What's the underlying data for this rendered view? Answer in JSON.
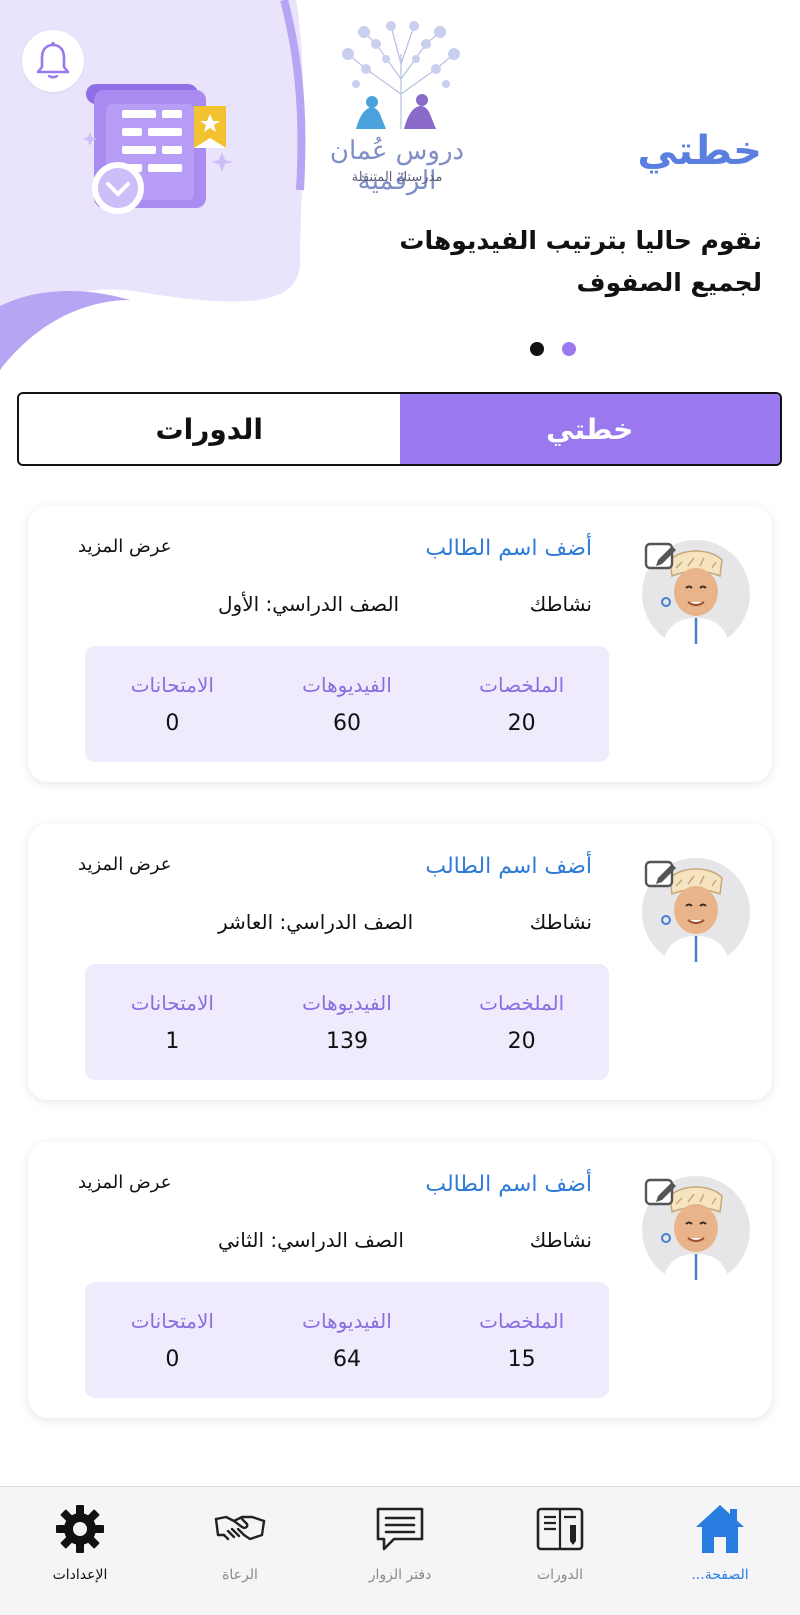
{
  "header": {
    "banner_title": "خطتي",
    "banner_text": "نقوم حاليا بترتيب الفيديوهات لجميع الصفوف",
    "logo_line1": "دروس عُمان الرقمية",
    "logo_line2": "مدرستك المتنقلة",
    "carousel_active_index": 1,
    "carousel_count": 2
  },
  "tabs": {
    "courses": "الدورات",
    "plan": "خطتي",
    "selected": "plan"
  },
  "students": [
    {
      "add_name": "أضف اسم الطالب",
      "more": "عرض المزيد",
      "activity": "نشاطك",
      "grade": "الصف الدراسي: الأول",
      "stats": [
        {
          "label": "الملخصات",
          "value": "20"
        },
        {
          "label": "الفيديوهات",
          "value": "60"
        },
        {
          "label": "الامتحانات",
          "value": "0"
        }
      ]
    },
    {
      "add_name": "أضف اسم الطالب",
      "more": "عرض المزيد",
      "activity": "نشاطك",
      "grade": "الصف الدراسي: العاشر",
      "stats": [
        {
          "label": "الملخصات",
          "value": "20"
        },
        {
          "label": "الفيديوهات",
          "value": "139"
        },
        {
          "label": "الامتحانات",
          "value": "1"
        }
      ]
    },
    {
      "add_name": "أضف اسم الطالب",
      "more": "عرض المزيد",
      "activity": "نشاطك",
      "grade": "الصف الدراسي: الثاني",
      "stats": [
        {
          "label": "الملخصات",
          "value": "15"
        },
        {
          "label": "الفيديوهات",
          "value": "64"
        },
        {
          "label": "الامتحانات",
          "value": "0"
        }
      ]
    }
  ],
  "bottom_nav": [
    {
      "label": "الإعدادات",
      "icon": "gear-icon"
    },
    {
      "label": "الرعاة",
      "icon": "handshake-icon"
    },
    {
      "label": "دفتر الزوار",
      "icon": "guestbook-icon"
    },
    {
      "label": "الدورات",
      "icon": "notebook-icon"
    },
    {
      "label": "الصفحة...",
      "icon": "home-icon",
      "active": true
    }
  ],
  "colors": {
    "accent": "#9a78ee",
    "title_blue": "#5b7fe0",
    "link_blue": "#2f7bd8",
    "stats_bg": "#efeafc",
    "home_active": "#2a7de0"
  }
}
